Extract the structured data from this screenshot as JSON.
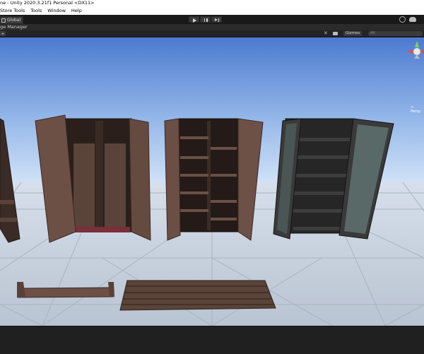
{
  "window": {
    "title": "ne - Unity 2020.3.21f1 Personal <DX11>"
  },
  "menu": {
    "items": [
      "Store Tools",
      "Tools",
      "Window",
      "Help"
    ]
  },
  "toolbar": {
    "pivot_label": "Global"
  },
  "scene_tab": {
    "label": "ge Manager"
  },
  "scene_options": {
    "gizmos_label": "Gizmos",
    "search_placeholder": "All"
  },
  "viewport": {
    "persp_label": "< Persp"
  },
  "colors": {
    "sky_top": "#4d7bd0",
    "sky_horizon": "#cbdff7",
    "floor": "#c8d2df",
    "wood_dark": "#3a2a24",
    "wood_mid": "#6b4f44"
  }
}
